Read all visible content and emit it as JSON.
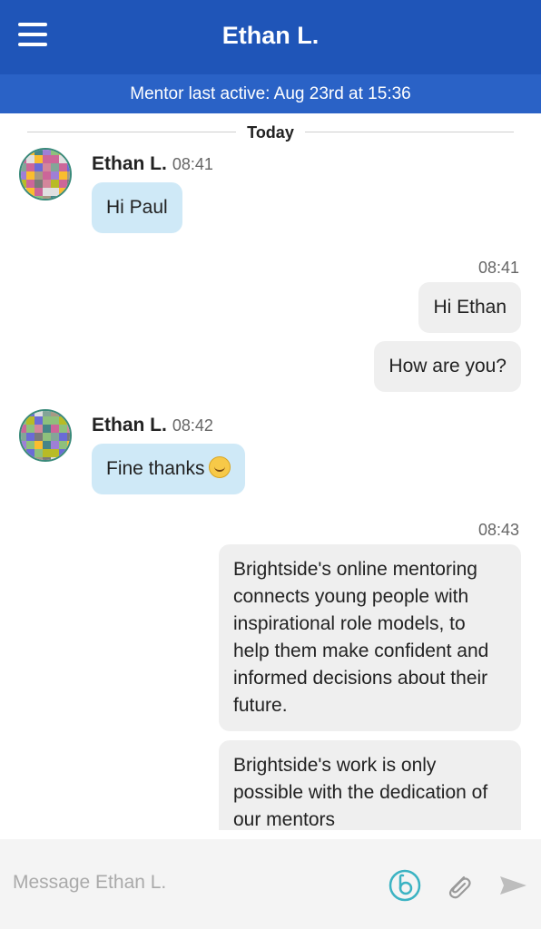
{
  "header": {
    "title": "Ethan L.",
    "status": "Mentor last active: Aug 23rd at 15:36",
    "menu_icon": "hamburger-menu-icon"
  },
  "divider": {
    "label": "Today"
  },
  "messages": [
    {
      "direction": "in",
      "sender": "Ethan L.",
      "time": "08:41",
      "text": "Hi Paul"
    },
    {
      "direction": "out",
      "time": "08:41",
      "text": "Hi Ethan"
    },
    {
      "direction": "out",
      "text": "How are you?"
    },
    {
      "direction": "in",
      "sender": "Ethan L.",
      "time": "08:42",
      "text": "Fine thanks",
      "emoji": "smiling-face-emoji"
    },
    {
      "direction": "out",
      "time": "08:43",
      "text": "Brightside's online mentoring connects young people with inspirational role models, to help them make confident and informed decisions about their future."
    },
    {
      "direction": "out",
      "text": "Brightside's work is only possible with the dedication of our mentors"
    }
  ],
  "composer": {
    "placeholder": "Message Ethan L.",
    "icons": [
      "brightside-logo-icon",
      "paperclip-icon",
      "send-icon"
    ]
  },
  "colors": {
    "header_bg": "#1f55b8",
    "subheader_bg": "#2a62c6",
    "incoming_bubble": "#cfe9f7",
    "outgoing_bubble": "#efefef",
    "accent": "#3bb3c3"
  }
}
